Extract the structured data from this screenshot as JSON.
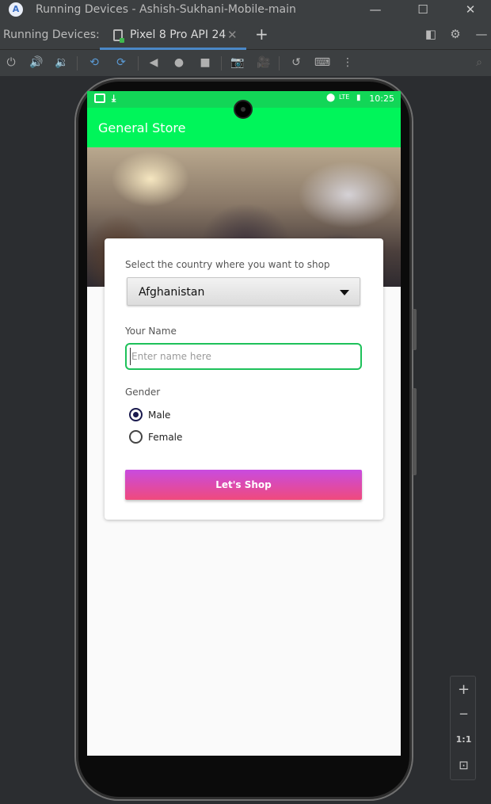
{
  "window": {
    "title": "Running Devices - Ashish-Sukhani-Mobile-main",
    "logo_letter": "A",
    "minimize": "—",
    "maximize": "☐",
    "close": "✕"
  },
  "tabbar": {
    "label": "Running Devices:",
    "tab_name": "Pixel 8 Pro API 24",
    "close_glyph": "✕",
    "add_glyph": "+",
    "icons": [
      "restore-layout-icon",
      "gear-icon",
      "minimize-panel-icon"
    ]
  },
  "toolbar": {
    "tools": [
      "power-icon",
      "volume-up-icon",
      "volume-down-icon",
      "rotate-left-icon",
      "rotate-right-icon",
      "back-icon",
      "home-icon",
      "overview-icon",
      "screenshot-icon",
      "screen-record-icon",
      "reset-icon",
      "keyboard-icon",
      "more-icon"
    ]
  },
  "device": {
    "status_time": "10:25",
    "status_lte": "LTE",
    "app_title": "General Store",
    "country_label": "Select the country where you want to shop",
    "country_value": "Afghanistan",
    "name_label": "Your Name",
    "name_placeholder": "Enter name here",
    "name_value": "",
    "gender_label": "Gender",
    "gender_options": [
      "Male",
      "Female"
    ],
    "gender_selected": "Male",
    "button_label": "Let's  Shop",
    "accent_color": "#00f55a",
    "button_gradient": [
      "#c84be0",
      "#f04a7c"
    ]
  },
  "nav": {
    "back": "◁",
    "home": "○",
    "recents": "□"
  },
  "zoom": {
    "zoom_in": "+",
    "zoom_out": "−",
    "actual_size": "1:1",
    "fit": "⊡"
  }
}
